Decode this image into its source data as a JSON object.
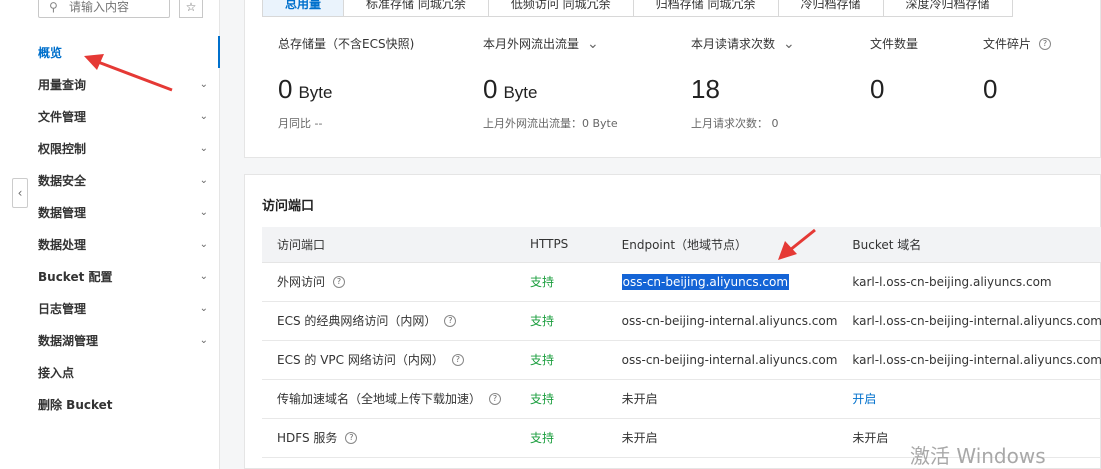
{
  "sidebar": {
    "search_placeholder": "请输入内容",
    "items": [
      {
        "label": "概览",
        "active": true,
        "chevron": false
      },
      {
        "label": "用量查询",
        "active": false,
        "chevron": true
      },
      {
        "label": "文件管理",
        "active": false,
        "chevron": true
      },
      {
        "label": "权限控制",
        "active": false,
        "chevron": true
      },
      {
        "label": "数据安全",
        "active": false,
        "chevron": true
      },
      {
        "label": "数据管理",
        "active": false,
        "chevron": true
      },
      {
        "label": "数据处理",
        "active": false,
        "chevron": true
      },
      {
        "label": "Bucket 配置",
        "active": false,
        "chevron": true
      },
      {
        "label": "日志管理",
        "active": false,
        "chevron": true
      },
      {
        "label": "数据湖管理",
        "active": false,
        "chevron": true
      },
      {
        "label": "接入点",
        "active": false,
        "chevron": false
      },
      {
        "label": "删除 Bucket",
        "active": false,
        "chevron": false
      }
    ]
  },
  "tabs": [
    "总用量",
    "标准存储 同城冗余",
    "低频访问 同城冗余",
    "归档存储 同城冗余",
    "冷归档存储",
    "深度冷归档存储"
  ],
  "stats": [
    {
      "label": "总存储量（不含ECS快照)",
      "value": "0",
      "unit": "Byte",
      "sub": "月同比 --"
    },
    {
      "label": "本月外网流出流量",
      "value": "0",
      "unit": "Byte",
      "sub": "上月外网流出流量：0 Byte"
    },
    {
      "label": "本月读请求次数",
      "value": "18",
      "unit": "",
      "sub": "上月请求次数：  0"
    },
    {
      "label": "文件数量",
      "value": "0",
      "unit": "",
      "sub": ""
    },
    {
      "label": "文件碎片",
      "value": "0",
      "unit": "",
      "sub": ""
    }
  ],
  "access": {
    "title": "访问端口",
    "headers": [
      "访问端口",
      "HTTPS",
      "Endpoint（地域节点）",
      "Bucket 域名"
    ],
    "rows": [
      {
        "port": "外网访问",
        "https": "支持",
        "endpoint": "oss-cn-beijing.aliyuncs.com",
        "bucket": "karl-l.oss-cn-beijing.aliyuncs.com"
      },
      {
        "port": "ECS 的经典网络访问（内网）",
        "https": "支持",
        "endpoint": "oss-cn-beijing-internal.aliyuncs.com",
        "bucket": "karl-l.oss-cn-beijing-internal.aliyuncs.com"
      },
      {
        "port": "ECS 的 VPC 网络访问（内网）",
        "https": "支持",
        "endpoint": "oss-cn-beijing-internal.aliyuncs.com",
        "bucket": "karl-l.oss-cn-beijing-internal.aliyuncs.com"
      },
      {
        "port": "传输加速域名（全地域上传下载加速）",
        "https": "支持",
        "endpoint": "未开启",
        "bucket": "开启"
      },
      {
        "port": "HDFS 服务",
        "https": "支持",
        "endpoint": "未开启",
        "bucket": "未开启"
      }
    ]
  },
  "watermark": "激活 Windows",
  "colors": {
    "accent": "#0070cc",
    "success": "#1b9e3e",
    "annotation": "#e53935"
  }
}
